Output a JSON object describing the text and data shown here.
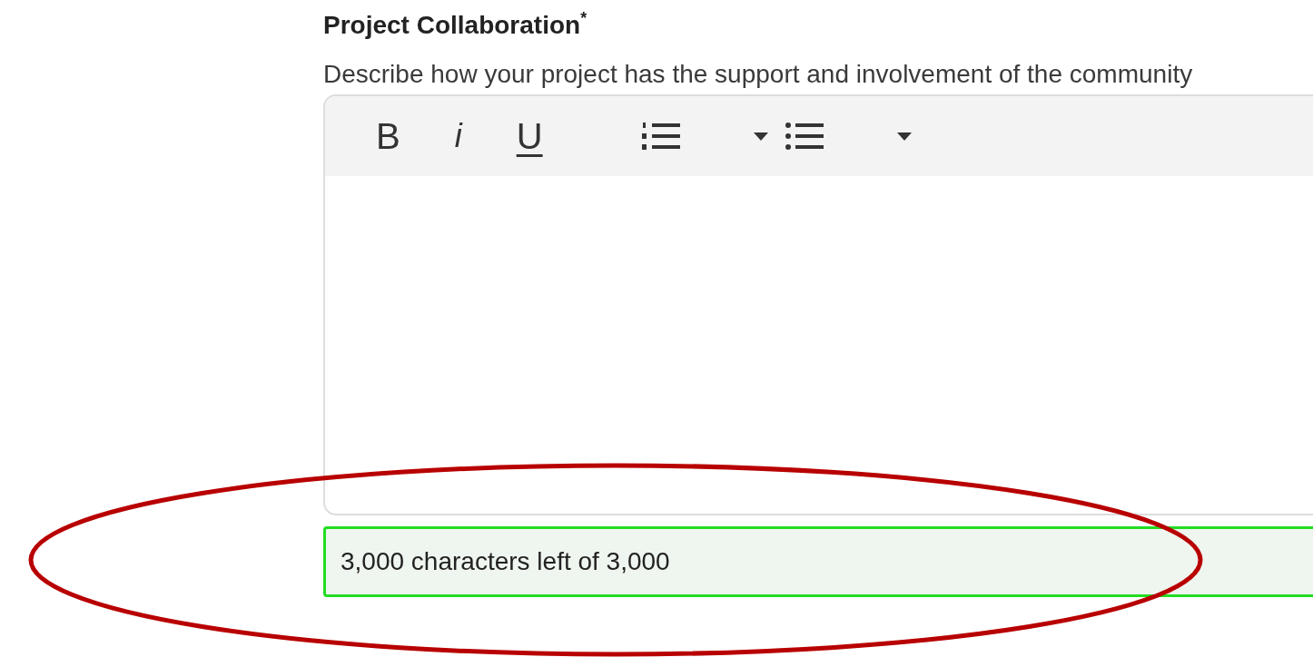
{
  "field": {
    "label": "Project Collaboration",
    "required_mark": "*",
    "description": "Describe how your project has the support and involvement of the community"
  },
  "toolbar": [
    {
      "kind": "bold",
      "label": "B"
    },
    {
      "kind": "italic",
      "label": "i"
    },
    {
      "kind": "underline",
      "label": "U"
    },
    {
      "kind": "ordered-list"
    },
    {
      "kind": "caret"
    },
    {
      "kind": "bullet-list"
    },
    {
      "kind": "caret"
    }
  ],
  "counter": {
    "text": "3,000 characters left of 3,000"
  },
  "annotation": {
    "kind": "ellipse"
  }
}
